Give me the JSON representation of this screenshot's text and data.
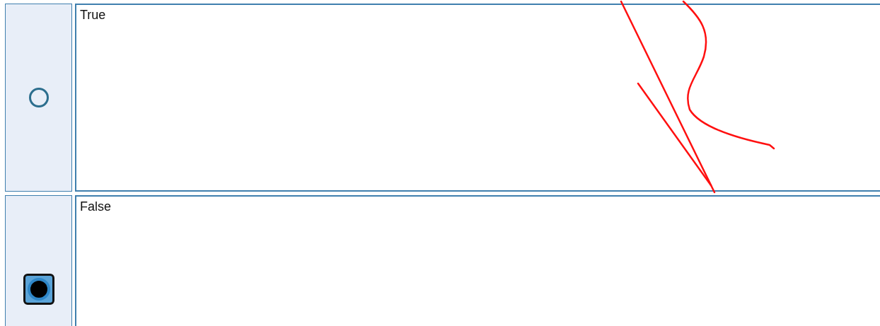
{
  "options": [
    {
      "label": "True",
      "selected": false
    },
    {
      "label": "False",
      "selected": true
    }
  ]
}
